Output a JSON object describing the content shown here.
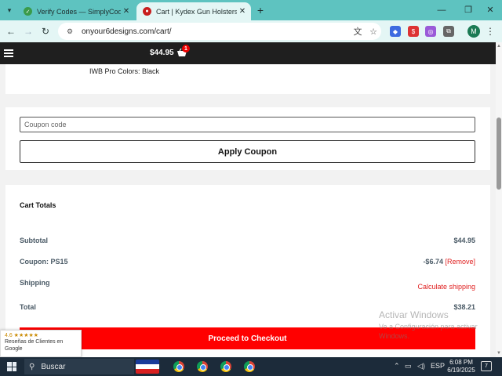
{
  "browser": {
    "tabs": [
      {
        "title": "Verify Codes — SimplyCodes",
        "icon": "simplycodes-icon",
        "active": false
      },
      {
        "title": "Cart | Kydex Gun Holsters | On Y",
        "icon": "site-favicon",
        "active": true
      }
    ],
    "url": "onyour6designs.com/cart/"
  },
  "header": {
    "cart_total": "$44.95",
    "cart_count": "1"
  },
  "item": {
    "variation": "IWB Pro Colors: Black"
  },
  "coupon": {
    "placeholder": "Coupon code",
    "value": "",
    "apply_label": "Apply Coupon"
  },
  "totals": {
    "title": "Cart Totals",
    "subtotal_label": "Subtotal",
    "subtotal_value": "$44.95",
    "coupon_label": "Coupon: PS15",
    "coupon_value": "-$6.74",
    "remove_label": "[Remove]",
    "shipping_label": "Shipping",
    "shipping_action": "Calculate shipping",
    "total_label": "Total",
    "total_value": "$38.21"
  },
  "checkout_label": "Proceed to Checkout",
  "reviews": {
    "rating": "4.6 ★★★★★",
    "text": "Reseñas de Clientes en Google"
  },
  "watermark": {
    "line1": "Activar Windows",
    "line2": "Ve a Configuración para activar Windows."
  },
  "taskbar": {
    "search_label": "Buscar",
    "language": "ESP",
    "time": "6:08 PM",
    "date": "6/19/2025",
    "notification_count": "7"
  },
  "colors": {
    "accent_red": "#ff0000",
    "tab_bar": "#5ec3c0",
    "header_bg": "#1f1f1f"
  }
}
